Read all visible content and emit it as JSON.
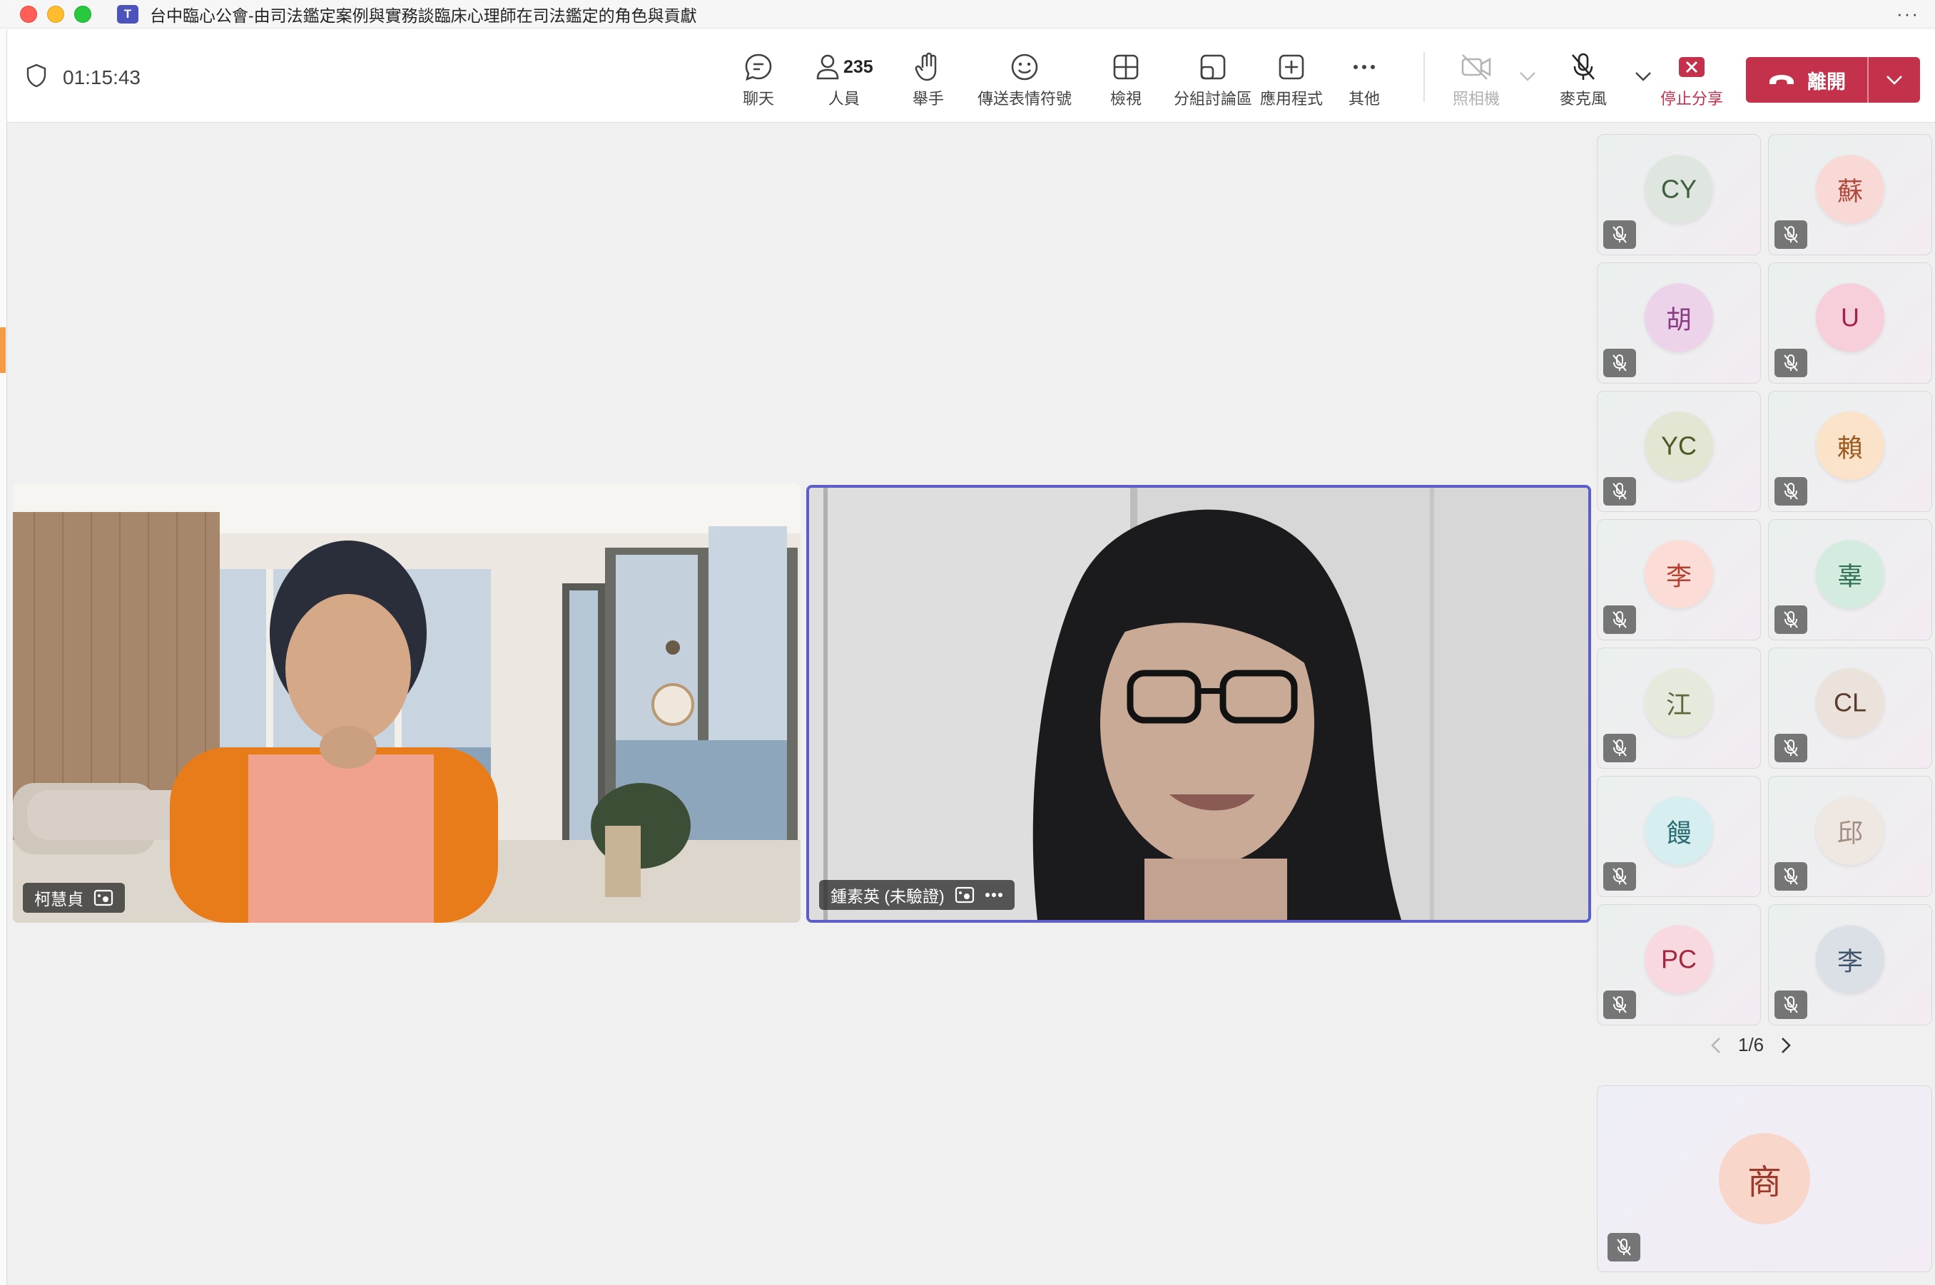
{
  "window": {
    "title": "台中臨心公會-由司法鑑定案例與實務談臨床心理師在司法鑑定的角色與貢獻",
    "app_logo": "T"
  },
  "toolbar": {
    "timer": "01:15:43",
    "people_count": "235",
    "buttons": {
      "chat": "聊天",
      "people": "人員",
      "raise_hand": "舉手",
      "reactions": "傳送表情符號",
      "view": "檢視",
      "rooms": "分組討論區",
      "apps": "應用程式",
      "more": "其他",
      "camera": "照相機",
      "mic": "麥克風",
      "stop_share": "停止分享"
    },
    "leave_label": "離開"
  },
  "videos": [
    {
      "name": "柯慧貞"
    },
    {
      "name": "鍾素英 (未驗證)"
    }
  ],
  "participants": [
    {
      "initials": "CY",
      "bg": "#dfe6df",
      "fg": "#3f5d3f"
    },
    {
      "initials": "蘇",
      "bg": "#f9d9d6",
      "fg": "#b04a3e"
    },
    {
      "initials": "胡",
      "bg": "#ecd3ea",
      "fg": "#8a3c85"
    },
    {
      "initials": "U",
      "bg": "#f7cfdb",
      "fg": "#a1234d"
    },
    {
      "initials": "YC",
      "bg": "#e4e6d4",
      "fg": "#4a5a22"
    },
    {
      "initials": "賴",
      "bg": "#fbe3c9",
      "fg": "#9a5a1f"
    },
    {
      "initials": "李",
      "bg": "#fbdcd6",
      "fg": "#b5402f"
    },
    {
      "initials": "辜",
      "bg": "#d4ecdf",
      "fg": "#2e7050"
    },
    {
      "initials": "江",
      "bg": "#e6eadc",
      "fg": "#5b6b3e"
    },
    {
      "initials": "CL",
      "bg": "#ece2dc",
      "fg": "#5a3b2e"
    },
    {
      "initials": "饅",
      "bg": "#d6eeef",
      "fg": "#2b6d72"
    },
    {
      "initials": "邱",
      "bg": "#efe7e1",
      "fg": "#a08f82"
    },
    {
      "initials": "PC",
      "bg": "#f8d9df",
      "fg": "#a3283f"
    },
    {
      "initials": "李",
      "bg": "#dae0e6",
      "fg": "#3f556b"
    }
  ],
  "pager": {
    "label": "1/6"
  },
  "featured_participant": {
    "initials": "商"
  }
}
